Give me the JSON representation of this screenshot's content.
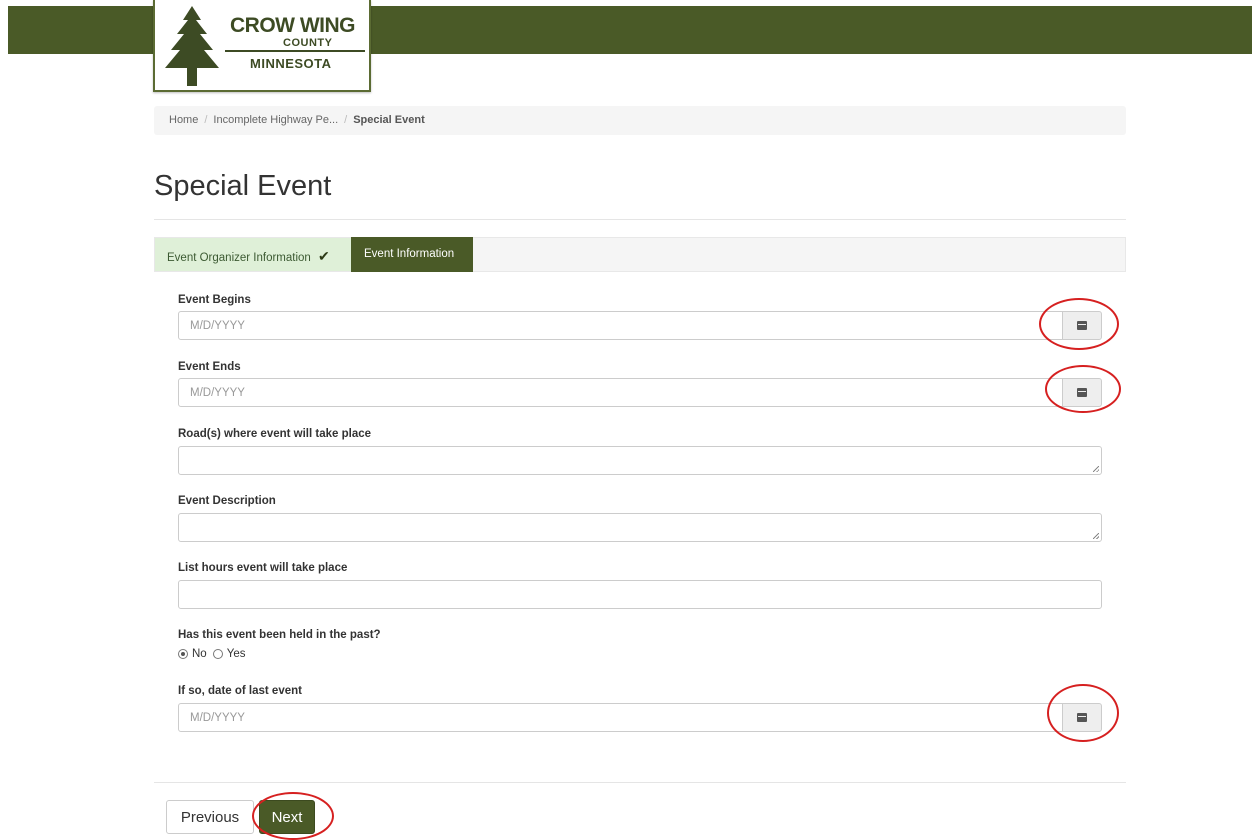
{
  "header": {
    "logo": {
      "line1": "CROW WING",
      "line2": "COUNTY",
      "line3": "MINNESOTA"
    },
    "brand_color": "#4a5a27"
  },
  "breadcrumb": {
    "items": [
      "Home",
      "Incomplete Highway Pe...",
      "Special Event"
    ]
  },
  "page_title": "Special Event",
  "steps": {
    "completed": "Event Organizer Information",
    "completed_icon": "checkmark-icon",
    "active": "Event Information"
  },
  "form": {
    "event_begins": {
      "label": "Event Begins",
      "placeholder": "M/D/YYYY"
    },
    "event_ends": {
      "label": "Event Ends",
      "placeholder": "M/D/YYYY"
    },
    "roads": {
      "label": "Road(s) where event will take place",
      "value": ""
    },
    "description": {
      "label": "Event Description",
      "value": ""
    },
    "hours": {
      "label": "List hours event will take place",
      "value": ""
    },
    "held_past": {
      "label": "Has this event been held in the past?",
      "options": [
        "No",
        "Yes"
      ],
      "selected": "No"
    },
    "last_event": {
      "label": "If so, date of last event",
      "placeholder": "M/D/YYYY"
    }
  },
  "buttons": {
    "previous": "Previous",
    "next": "Next"
  },
  "annotations": {
    "highlight_color": "#d62020"
  }
}
